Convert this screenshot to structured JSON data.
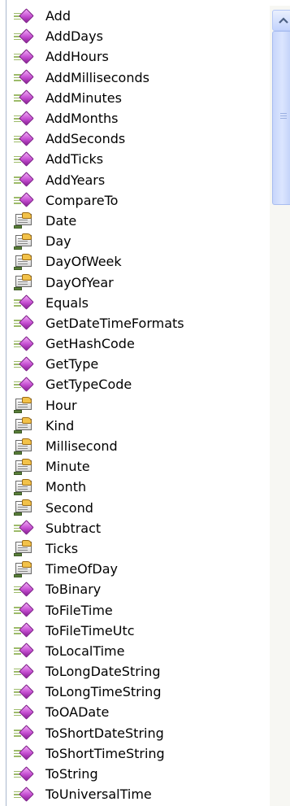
{
  "members": [
    {
      "label": "Add",
      "kind": "method"
    },
    {
      "label": "AddDays",
      "kind": "method"
    },
    {
      "label": "AddHours",
      "kind": "method"
    },
    {
      "label": "AddMilliseconds",
      "kind": "method"
    },
    {
      "label": "AddMinutes",
      "kind": "method"
    },
    {
      "label": "AddMonths",
      "kind": "method"
    },
    {
      "label": "AddSeconds",
      "kind": "method"
    },
    {
      "label": "AddTicks",
      "kind": "method"
    },
    {
      "label": "AddYears",
      "kind": "method"
    },
    {
      "label": "CompareTo",
      "kind": "method"
    },
    {
      "label": "Date",
      "kind": "property"
    },
    {
      "label": "Day",
      "kind": "property"
    },
    {
      "label": "DayOfWeek",
      "kind": "property"
    },
    {
      "label": "DayOfYear",
      "kind": "property"
    },
    {
      "label": "Equals",
      "kind": "method"
    },
    {
      "label": "GetDateTimeFormats",
      "kind": "method"
    },
    {
      "label": "GetHashCode",
      "kind": "method"
    },
    {
      "label": "GetType",
      "kind": "method"
    },
    {
      "label": "GetTypeCode",
      "kind": "method"
    },
    {
      "label": "Hour",
      "kind": "property"
    },
    {
      "label": "Kind",
      "kind": "property"
    },
    {
      "label": "Millisecond",
      "kind": "property"
    },
    {
      "label": "Minute",
      "kind": "property"
    },
    {
      "label": "Month",
      "kind": "property"
    },
    {
      "label": "Second",
      "kind": "property"
    },
    {
      "label": "Subtract",
      "kind": "method"
    },
    {
      "label": "Ticks",
      "kind": "property"
    },
    {
      "label": "TimeOfDay",
      "kind": "property"
    },
    {
      "label": "ToBinary",
      "kind": "method"
    },
    {
      "label": "ToFileTime",
      "kind": "method"
    },
    {
      "label": "ToFileTimeUtc",
      "kind": "method"
    },
    {
      "label": "ToLocalTime",
      "kind": "method"
    },
    {
      "label": "ToLongDateString",
      "kind": "method"
    },
    {
      "label": "ToLongTimeString",
      "kind": "method"
    },
    {
      "label": "ToOADate",
      "kind": "method"
    },
    {
      "label": "ToShortDateString",
      "kind": "method"
    },
    {
      "label": "ToShortTimeString",
      "kind": "method"
    },
    {
      "label": "ToString",
      "kind": "method"
    },
    {
      "label": "ToUniversalTime",
      "kind": "method"
    }
  ],
  "icons": {
    "method": "method-icon",
    "property": "property-icon"
  },
  "colors": {
    "border": "#a9b8cf",
    "scroll_thumb": "#c7d6fb",
    "method_icon": "#c44dd0"
  },
  "scroll": {
    "position": 0.0,
    "visible_fraction": 0.21
  }
}
